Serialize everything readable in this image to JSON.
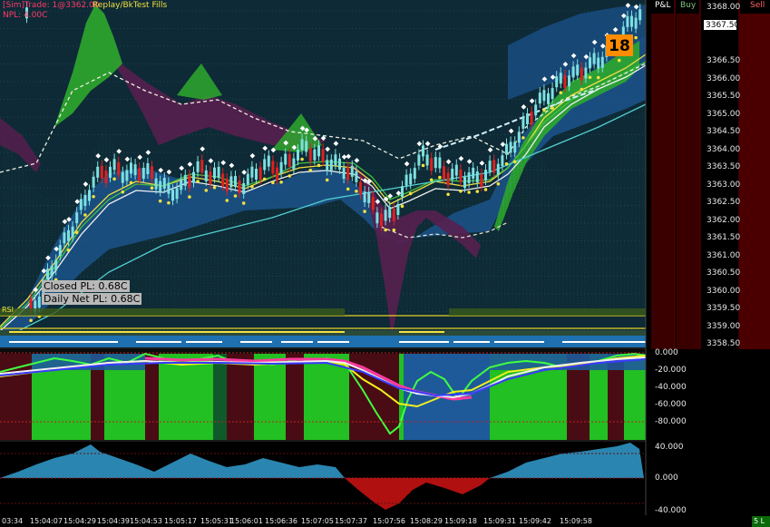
{
  "header": {
    "sim_tag": "[Sim]",
    "trade_text": "Trade: 1@3362.00",
    "mode_text": "Replay/BkTest Fills",
    "npl_text": "NPL: 4.00C"
  },
  "overlay": {
    "closed_pl": "Closed PL: 0.68C",
    "daily_net_pl": "Daily Net PL: 0.68C",
    "rsi_label": "RSI"
  },
  "badge": {
    "value": "18",
    "color": "#ff8c00"
  },
  "dom": {
    "pl_header": "P&L",
    "buy_header": "Buy",
    "sell_header": "Sell"
  },
  "price_axis": {
    "labels": [
      "3368.00",
      "3367.00",
      "3366.50",
      "3366.00",
      "3365.50",
      "3365.00",
      "3364.50",
      "3364.00",
      "3363.50",
      "3363.00",
      "3362.50",
      "3362.00",
      "3361.50",
      "3361.00",
      "3360.50",
      "3360.00",
      "3359.50",
      "3359.00",
      "3358.50"
    ],
    "current": "3367.50"
  },
  "osc_axis": {
    "labels": [
      "0.000",
      "-20.000",
      "-40.000",
      "-60.000",
      "-80.000"
    ]
  },
  "hist_axis": {
    "labels": [
      "40.000",
      "0.000",
      "-40.000"
    ]
  },
  "time_axis": {
    "labels": [
      "03:34",
      "15:04:07",
      "15:04:29",
      "15:04:39",
      "15:04:53",
      "15:05:17",
      "15:05:31",
      "15:06:01",
      "15:06:36",
      "15:07:05",
      "15:07:37",
      "15:07:56",
      "15:08:29",
      "15:09:18",
      "15:09:31",
      "15:09:42",
      "15:09:58"
    ]
  },
  "status": {
    "corner": "5 L"
  },
  "colors": {
    "background": "#0e2a36",
    "bull_candle": "#7de0e0",
    "bear_candle": "#e02020",
    "cloud_green": "#2ea82e",
    "cloud_purple": "#5a1e50",
    "band_blue": "#1e5a9a",
    "osc_green": "#22c022",
    "osc_maroon": "#4a0c14",
    "hist_blue": "#2a86b0",
    "hist_red": "#b01010"
  }
}
